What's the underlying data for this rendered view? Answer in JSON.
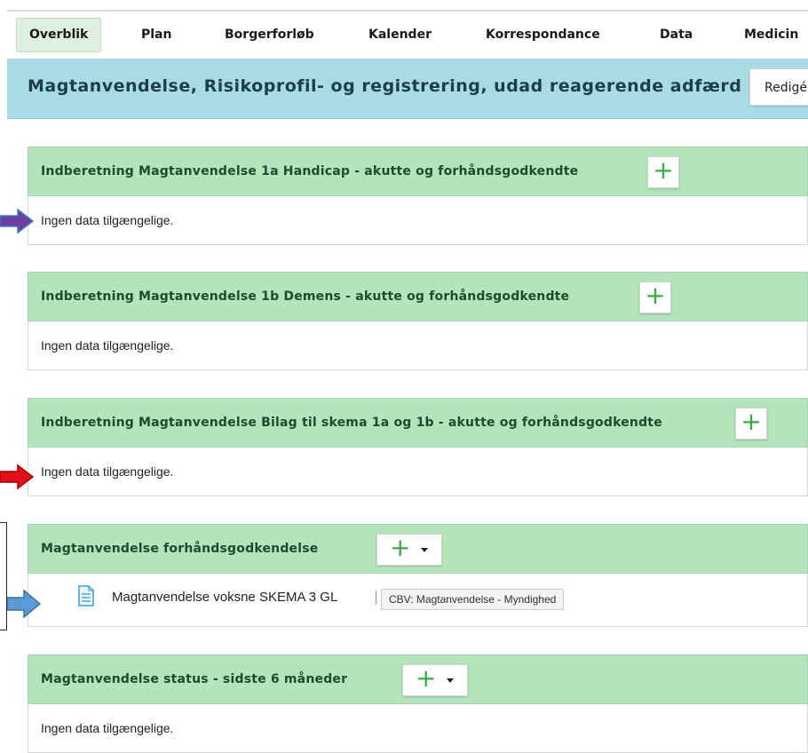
{
  "nav": {
    "tabs": [
      {
        "label": "Overblik",
        "active": true
      },
      {
        "label": "Plan"
      },
      {
        "label": "Borgerforløb"
      },
      {
        "label": "Kalender"
      },
      {
        "label": "Korrespondance"
      },
      {
        "label": "Data"
      },
      {
        "label": "Medicin"
      }
    ]
  },
  "page": {
    "title": "Magtanvendelse, Risikoprofil- og registrering, udad reagerende adfærd",
    "edit_label": "Redigér"
  },
  "sections": [
    {
      "title": "Indberetning Magtanvendelse 1a Handicap - akutte og forhåndsgodkendte",
      "body": "Ingen data tilgængelige."
    },
    {
      "title": "Indberetning Magtanvendelse 1b Demens - akutte og forhåndsgodkendte",
      "body": "Ingen data tilgængelige."
    },
    {
      "title": "Indberetning Magtanvendelse Bilag til skema 1a og 1b - akutte og forhåndsgodkendte",
      "body": "Ingen data tilgængelige."
    },
    {
      "title": "Magtanvendelse forhåndsgodkendelse",
      "document": {
        "name": "Magtanvendelse voksne SKEMA 3 GL",
        "separator": "|",
        "badge": "CBV: Magtanvendelse - Myndighed"
      }
    },
    {
      "title": "Magtanvendelse status - sidste 6 måneder",
      "body": "Ingen data tilgængelige."
    }
  ],
  "icons": {
    "plus": "+",
    "document": "document-icon",
    "caret": "chevron-down-icon"
  },
  "colors": {
    "title_bar": "#a8dbe5",
    "section_header": "#b3e4bb",
    "plus": "#3aaa47",
    "arrow_purple": "#6a3fa0",
    "arrow_red": "#e0101a",
    "arrow_blue": "#5b9bd5"
  }
}
